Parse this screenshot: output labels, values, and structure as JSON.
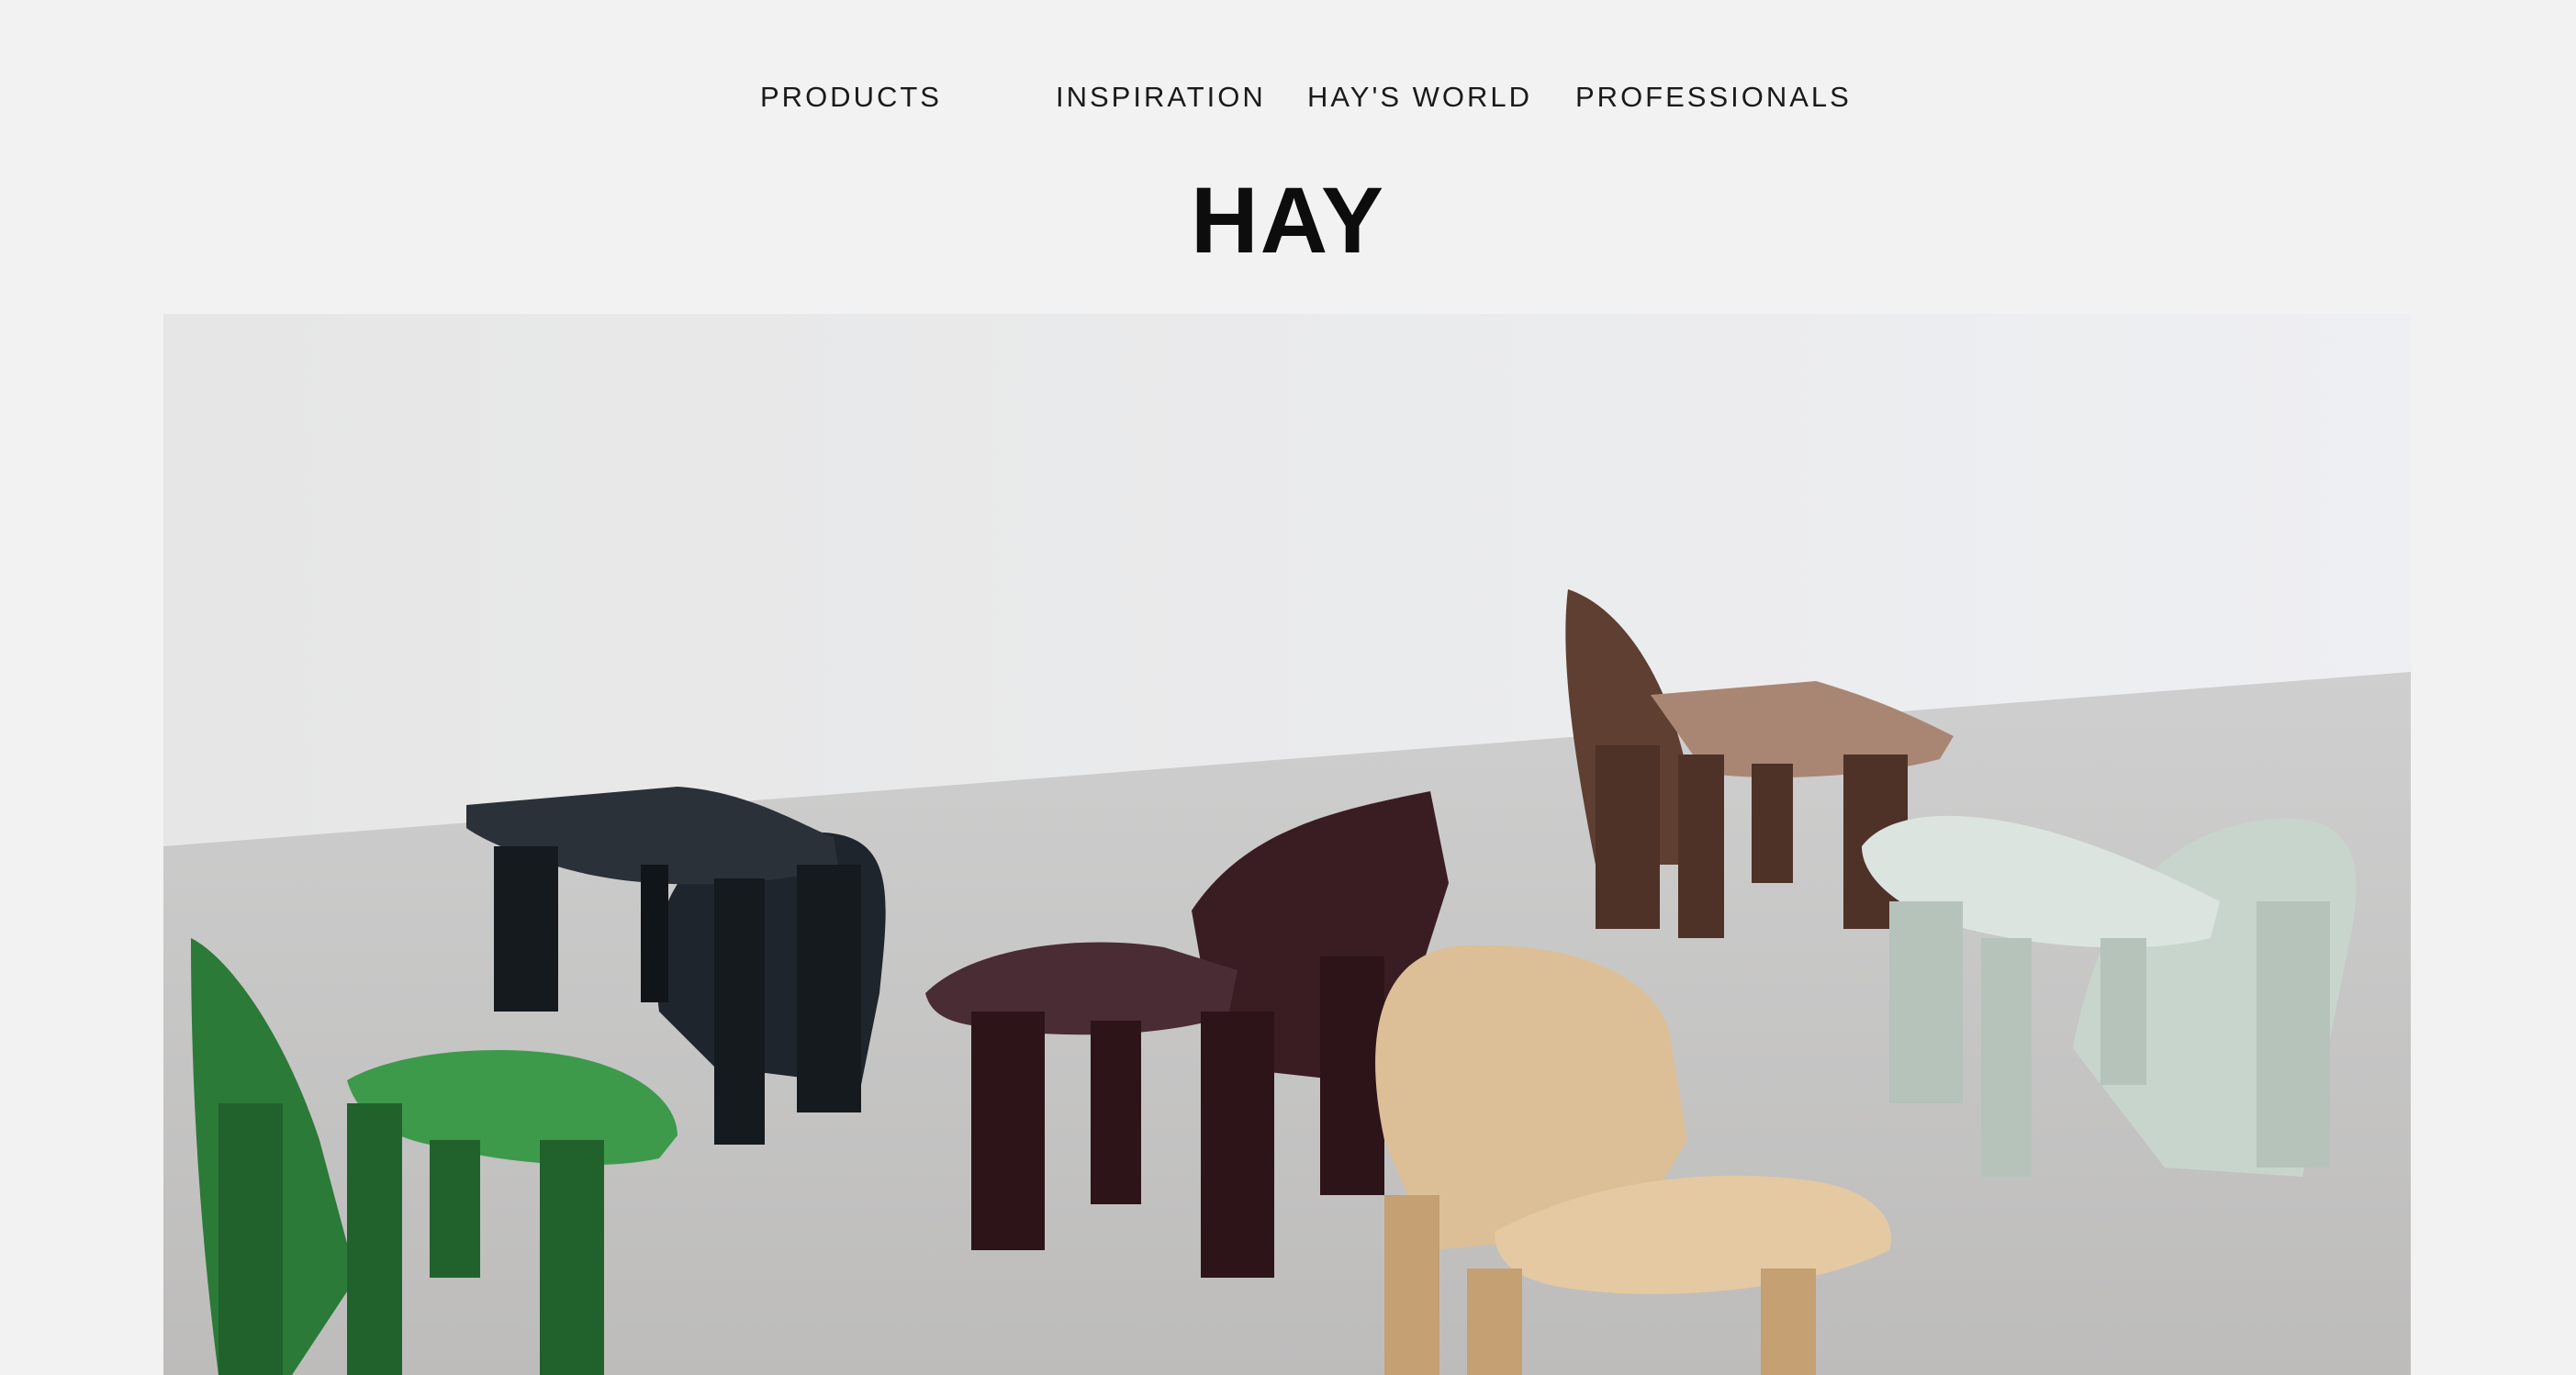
{
  "nav": {
    "items": [
      {
        "label": "PRODUCTS"
      },
      {
        "label": "INSPIRATION"
      },
      {
        "label": "HAY'S WORLD"
      },
      {
        "label": "PROFESSIONALS"
      }
    ]
  },
  "brand": {
    "logo": "HAY"
  },
  "hero": {
    "chairs": [
      {
        "name": "green-lounge-chair",
        "color": "#2e7d3a"
      },
      {
        "name": "black-lounge-chair",
        "color": "#1c232a"
      },
      {
        "name": "aubergine-lounge-chair",
        "color": "#3b1d22"
      },
      {
        "name": "walnut-lounge-chair",
        "color": "#6b4a3a"
      },
      {
        "name": "oak-lounge-chair",
        "color": "#d8b98f"
      },
      {
        "name": "mint-lounge-chair",
        "color": "#cdd8d1"
      }
    ]
  }
}
